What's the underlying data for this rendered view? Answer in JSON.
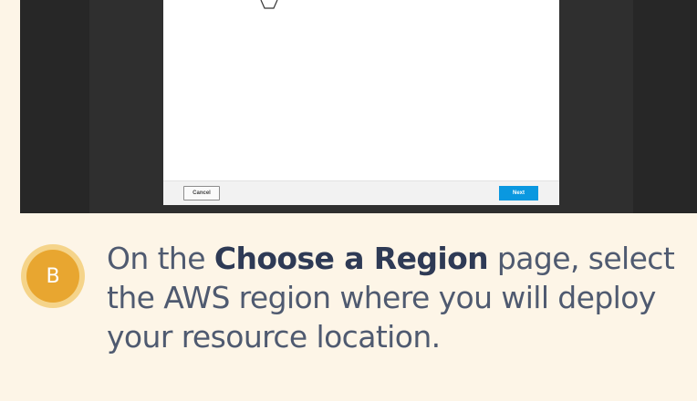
{
  "dialog": {
    "cancel_label": "Cancel",
    "next_label": "Next",
    "top_icon": "hexagon-icon"
  },
  "step": {
    "letter": "B",
    "text_before": "On the ",
    "text_bold": "Choose a Region",
    "text_after": " page, select the AWS region where you will deploy your resource location."
  },
  "colors": {
    "background": "#fdf5e7",
    "next_button": "#0a98e0",
    "badge": "#e8a630",
    "text": "#4f5a70"
  }
}
